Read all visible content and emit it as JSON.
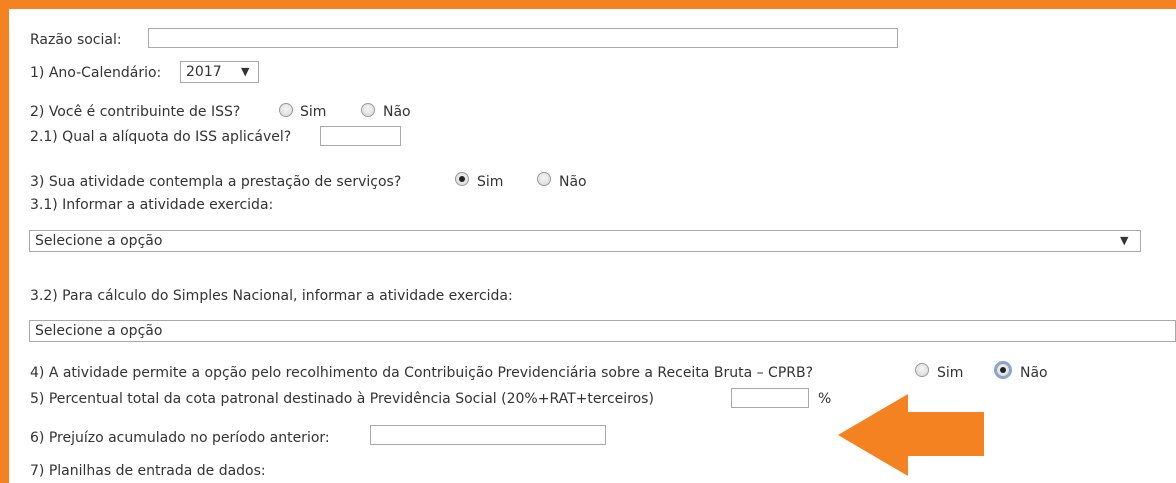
{
  "form": {
    "razao_label": "Razão social:",
    "razao_value": "",
    "q1_label": "1) Ano-Calendário:",
    "q1_value": "2017",
    "q2_label": "2) Você é contribuinte de ISS?",
    "q2_sim": "Sim",
    "q2_nao": "Não",
    "q2_selected": "none",
    "q21_label": "2.1) Qual a alíquota do ISS aplicável?",
    "q21_value": "",
    "q3_label": "3) Sua atividade contempla a prestação de serviços?",
    "q3_sim": "Sim",
    "q3_nao": "Não",
    "q3_selected": "Sim",
    "q31_label": "3.1) Informar a atividade exercida:",
    "q31_select": "Selecione a opção",
    "q32_label": "3.2) Para cálculo do Simples Nacional, informar a atividade exercida:",
    "q32_select": "Selecione a opção",
    "q4_label": "4) A atividade permite a opção pelo recolhimento da Contribuição Previdenciária sobre a Receita Bruta – CPRB?",
    "q4_sim": "Sim",
    "q4_nao": "Não",
    "q4_selected": "Não",
    "q5_label": "5) Percentual total da cota patronal destinado à Previdência Social (20%+RAT+terceiros)",
    "q5_value": "",
    "q5_unit": "%",
    "q6_label": "6) Prejuízo acumulado no período anterior:",
    "q6_value": "",
    "q7_label": "7) Planilhas de entrada de dados:"
  },
  "colors": {
    "accent": "#f58220"
  },
  "icons": {
    "dropdown": "caret-down-icon",
    "annotation": "arrow-left-icon"
  }
}
